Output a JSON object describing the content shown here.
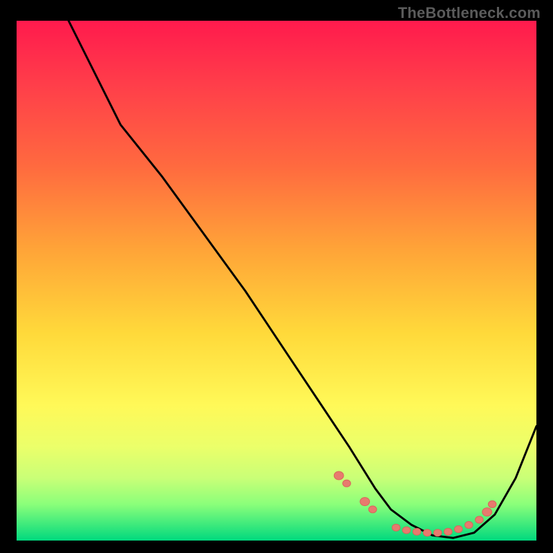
{
  "watermark": "TheBottleneck.com",
  "chart_data": {
    "type": "line",
    "title": "",
    "xlabel": "",
    "ylabel": "",
    "xlim": [
      0,
      100
    ],
    "ylim": [
      0,
      100
    ],
    "grid": false,
    "legend": false,
    "series": [
      {
        "name": "curve",
        "x": [
          0,
          8,
          16,
          20,
          28,
          36,
          44,
          52,
          58,
          64,
          69,
          72,
          76,
          80,
          84,
          88,
          92,
          96,
          100
        ],
        "y": [
          120,
          104,
          88,
          80,
          70,
          59,
          48,
          36,
          27,
          18,
          10,
          6,
          3,
          1,
          0.5,
          1.5,
          5,
          12,
          22
        ]
      }
    ],
    "markers": [
      {
        "x": 62,
        "y": 12.5,
        "r": 6
      },
      {
        "x": 63.5,
        "y": 11,
        "r": 5
      },
      {
        "x": 67,
        "y": 7.5,
        "r": 6
      },
      {
        "x": 68.5,
        "y": 6,
        "r": 5
      },
      {
        "x": 73,
        "y": 2.5,
        "r": 5
      },
      {
        "x": 75,
        "y": 2,
        "r": 5
      },
      {
        "x": 77,
        "y": 1.7,
        "r": 5
      },
      {
        "x": 79,
        "y": 1.5,
        "r": 5
      },
      {
        "x": 81,
        "y": 1.5,
        "r": 5
      },
      {
        "x": 83,
        "y": 1.7,
        "r": 5
      },
      {
        "x": 85,
        "y": 2.2,
        "r": 5
      },
      {
        "x": 87,
        "y": 3,
        "r": 5
      },
      {
        "x": 89,
        "y": 4,
        "r": 5
      },
      {
        "x": 90.5,
        "y": 5.5,
        "r": 6
      },
      {
        "x": 91.5,
        "y": 7,
        "r": 5
      }
    ],
    "colors": {
      "curve": "#000000",
      "marker_fill": "#e77a6e",
      "marker_stroke": "#d9665a"
    }
  }
}
